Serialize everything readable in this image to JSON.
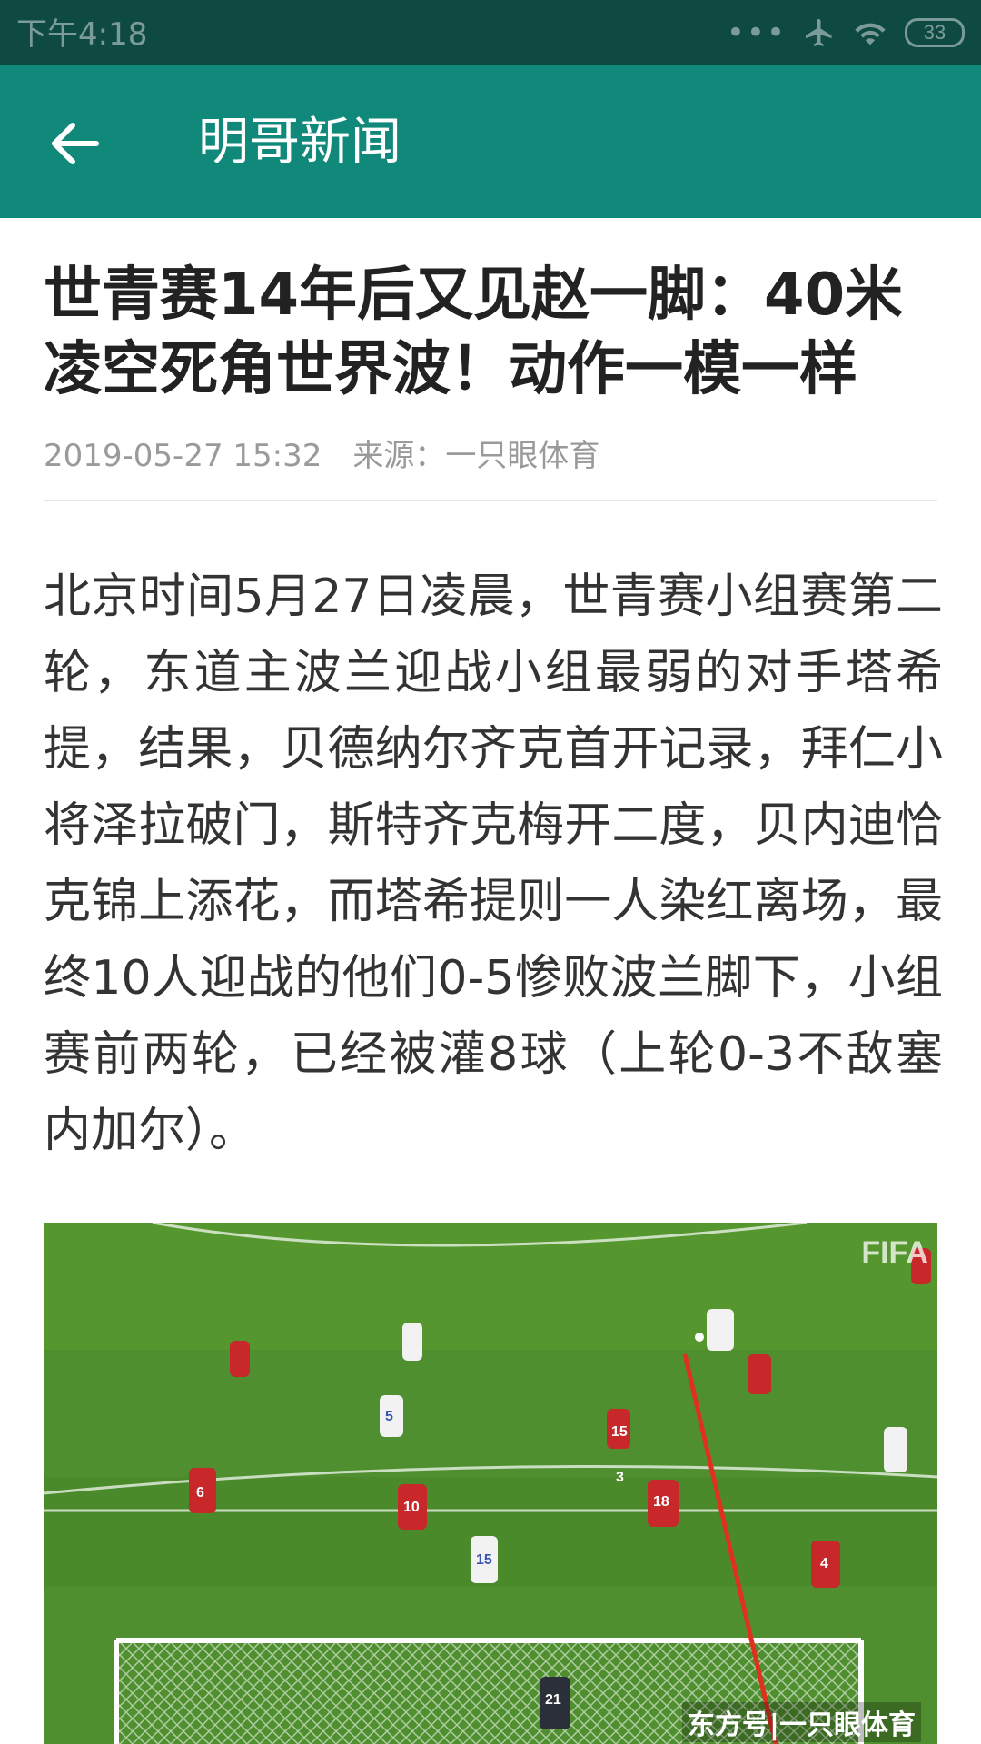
{
  "status_bar": {
    "time": "下午4:18",
    "battery": "33",
    "icons": [
      "more-dots-icon",
      "airplane-icon",
      "wifi-icon",
      "battery-icon"
    ]
  },
  "app_bar": {
    "back_icon": "arrow-left-icon",
    "title": "明哥新闻"
  },
  "article": {
    "title": "世青赛14年后又见赵一脚：40米凌空死角世界波！动作一模一样",
    "date": "2019-05-27 15:32",
    "source": "来源：一只眼体育",
    "body": "北京时间5月27日凌晨，世青赛小组赛第二轮，东道主波兰迎战小组最弱的对手塔希提，结果，贝德纳尔齐克首开记录，拜仁小将泽拉破门，斯特齐克梅开二度，贝内迪恰克锦上添花，而塔希提则一人染红离场，最终10人迎战的他们0-5惨败波兰脚下，小组赛前两轮，已经被灌8球（上轮0-3不敌塞内加尔）。",
    "image": {
      "watermark_top": "FIFA",
      "watermark_bottom": "东方号|一只眼体育",
      "jersey_numbers": [
        "15",
        "5",
        "3",
        "6",
        "10",
        "18",
        "15",
        "4",
        "21"
      ]
    }
  },
  "colors": {
    "status_bar": "#0e4a42",
    "app_bar": "#10897a",
    "title_text": "#222222",
    "meta_text": "#9a9a9a",
    "body_text": "#333333",
    "pitch": "#4f8f2f"
  }
}
